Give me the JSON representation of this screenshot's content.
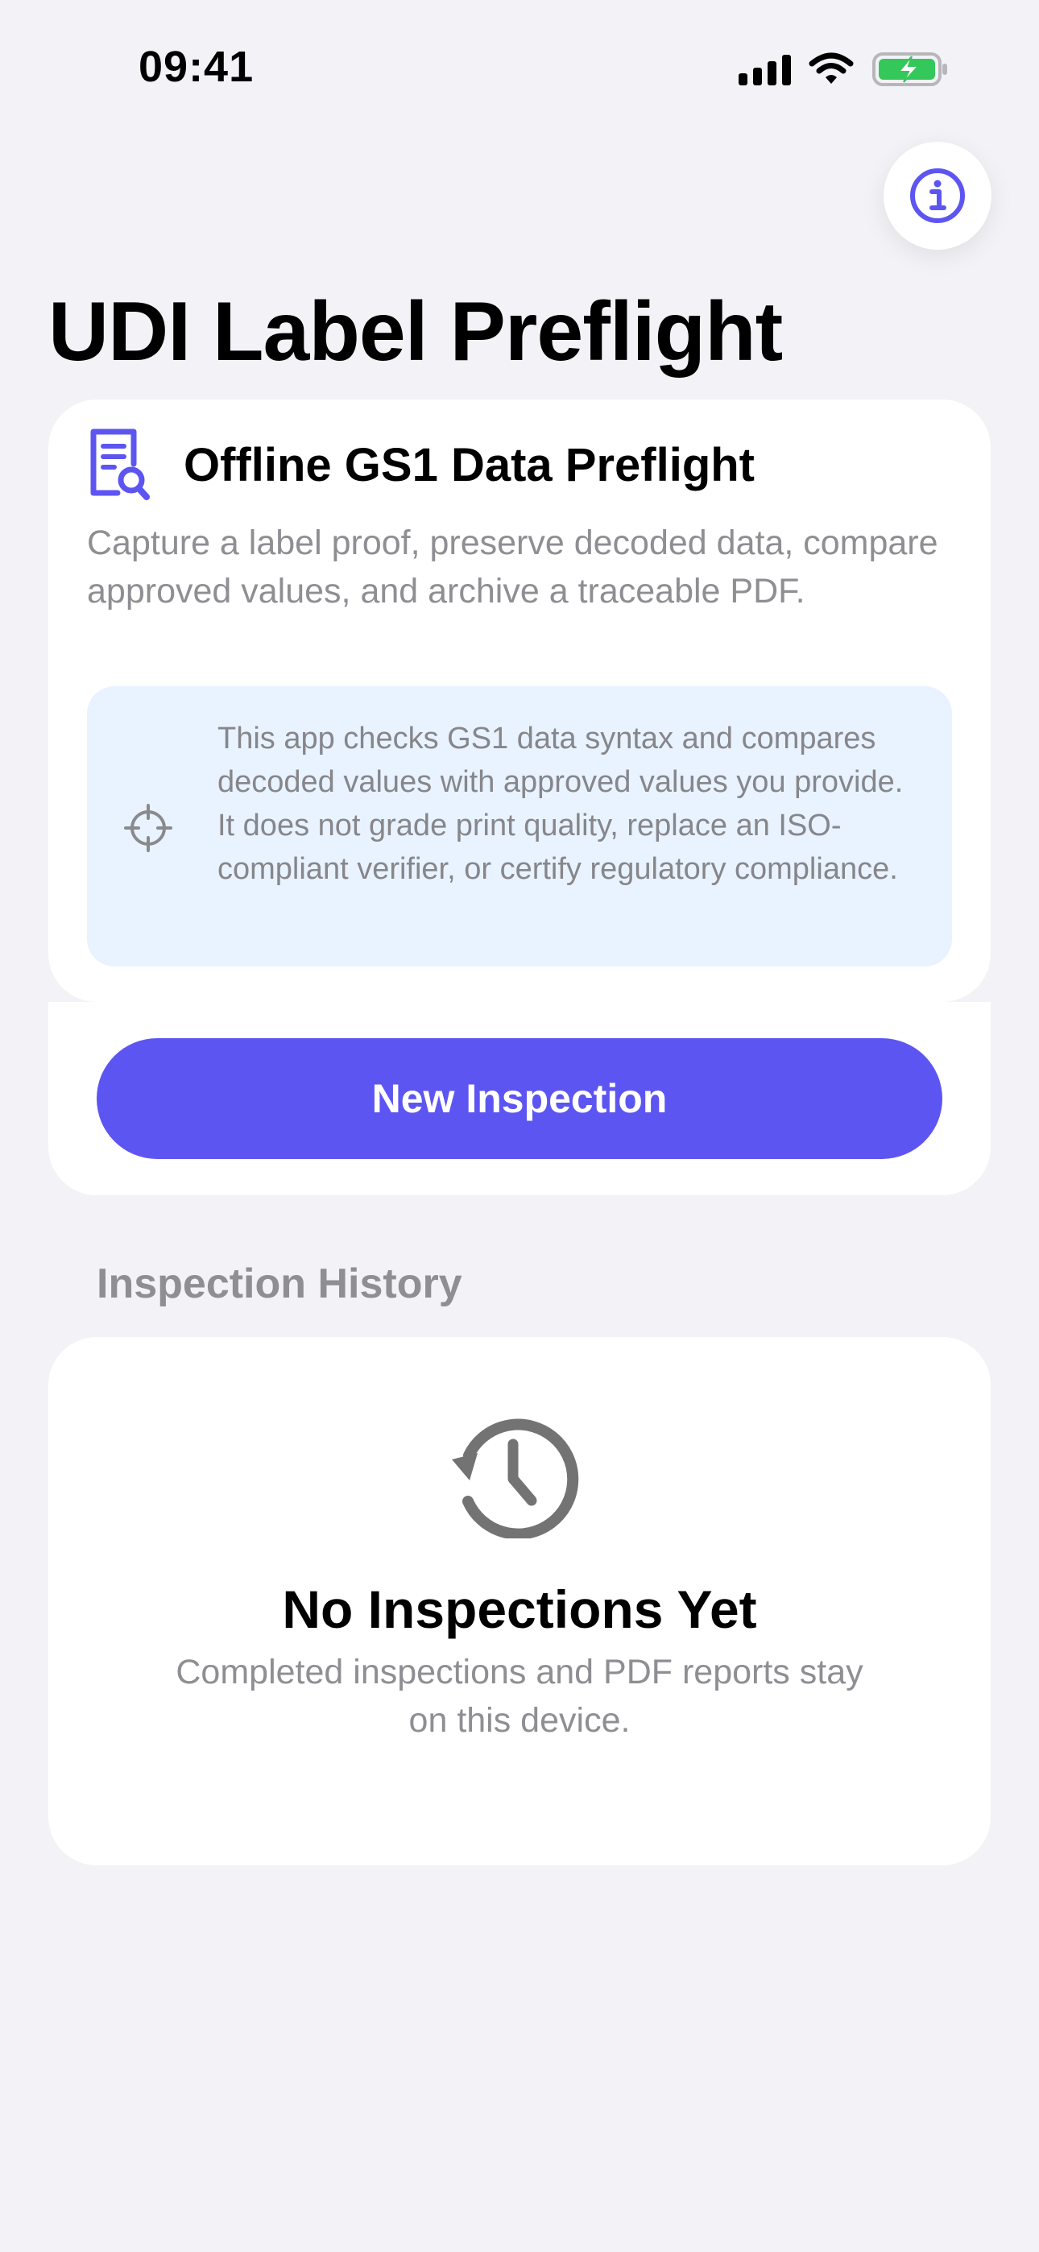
{
  "status_bar": {
    "time": "09:41",
    "icons": [
      "cellular-signal-icon",
      "wifi-icon",
      "battery-charging-icon"
    ],
    "battery_color": "#34c759"
  },
  "header": {
    "info_icon": "info-circle-icon",
    "title": "UDI Label Preflight"
  },
  "intro_card": {
    "icon": "document-search-icon",
    "title": "Offline GS1 Data Preflight",
    "description": "Capture a label proof, preserve decoded data, compare approved values, and archive a traceable PDF.",
    "notice": {
      "icon": "crosshair-icon",
      "text": "This app checks GS1 data syntax and compares decoded values with approved values you provide. It does not grade print quality, replace an ISO-compliant verifier, or certify regulatory compliance."
    },
    "primary_button": "New Inspection"
  },
  "history": {
    "section_label": "Inspection History",
    "empty_icon": "clock-history-icon",
    "empty_title": "No Inspections Yet",
    "empty_description": "Completed inspections and PDF reports stay on this device."
  },
  "colors": {
    "accent": "#5d55f2",
    "background": "#f2f2f7",
    "notice_background": "#e8f3ff",
    "secondary_text": "#8e8e93"
  }
}
